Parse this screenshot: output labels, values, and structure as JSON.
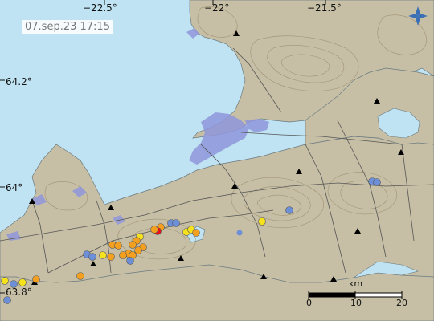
{
  "map": {
    "timestamp": "07.sep.23  17:15",
    "longitude_labels": [
      "−22.5°",
      "−22°",
      "−21.5°"
    ],
    "latitude_labels": [
      "64.2°",
      "64°",
      "63.8°"
    ],
    "scale_bar": {
      "unit": "km",
      "ticks": [
        "0",
        "10",
        "20"
      ]
    },
    "colors": {
      "sea": "#bfe3f2",
      "land": "#c6bfa5",
      "contour": "#9c8a6c",
      "urban": "#8f97dc",
      "road": "#555555",
      "station": "#000000"
    },
    "quake_legend_colors": {
      "red": "#e8101a",
      "orange": "#f3a020",
      "yellow": "#f5e21c",
      "blue": "#6d8fd8"
    },
    "compass_icon": "north-arrow-icon"
  }
}
